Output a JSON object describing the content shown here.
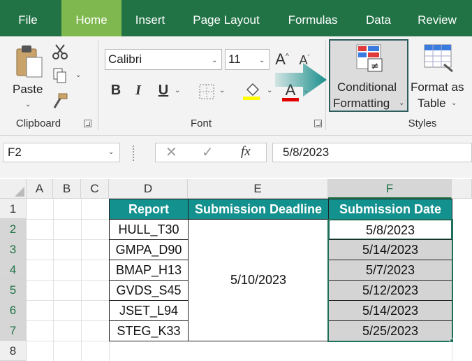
{
  "ribbon_tabs": [
    "File",
    "Home",
    "Insert",
    "Page Layout",
    "Formulas",
    "Data",
    "Review"
  ],
  "active_tab": "Home",
  "clipboard": {
    "paste_label": "Paste",
    "group_label": "Clipboard"
  },
  "font": {
    "name": "Calibri",
    "size": "11",
    "group_label": "Font",
    "bold": "B",
    "italic": "I",
    "underline": "U",
    "font_color_letter": "A"
  },
  "styles": {
    "cf_label_line1": "Conditional",
    "cf_label_line2": "Formatting",
    "fat_label_line1": "Format as",
    "fat_label_line2": "Table",
    "group_label": "Styles"
  },
  "formula_bar": {
    "name_box": "F2",
    "fx": "fx",
    "value": "5/8/2023"
  },
  "columns": [
    "A",
    "B",
    "C",
    "D",
    "E",
    "F"
  ],
  "rows": [
    "1",
    "2",
    "3",
    "4",
    "5",
    "6",
    "7",
    "8"
  ],
  "selected_column": "F",
  "table": {
    "headers": [
      "Report",
      "Submission Deadline",
      "Submission Date"
    ],
    "deadline": "5/10/2023",
    "rows": [
      {
        "report": "HULL_T30",
        "date": "5/8/2023"
      },
      {
        "report": "GMPA_D90",
        "date": "5/14/2023"
      },
      {
        "report": "BMAP_H13",
        "date": "5/7/2023"
      },
      {
        "report": "GVDS_S45",
        "date": "5/12/2023"
      },
      {
        "report": "JSET_L94",
        "date": "5/14/2023"
      },
      {
        "report": "STEG_K33",
        "date": "5/25/2023"
      }
    ]
  },
  "colors": {
    "excel_green": "#217346",
    "active_tab": "#7fb84e",
    "table_header": "#13918e",
    "shaded_cell": "#d4d4d4",
    "arrow": "#1a8f8c"
  }
}
